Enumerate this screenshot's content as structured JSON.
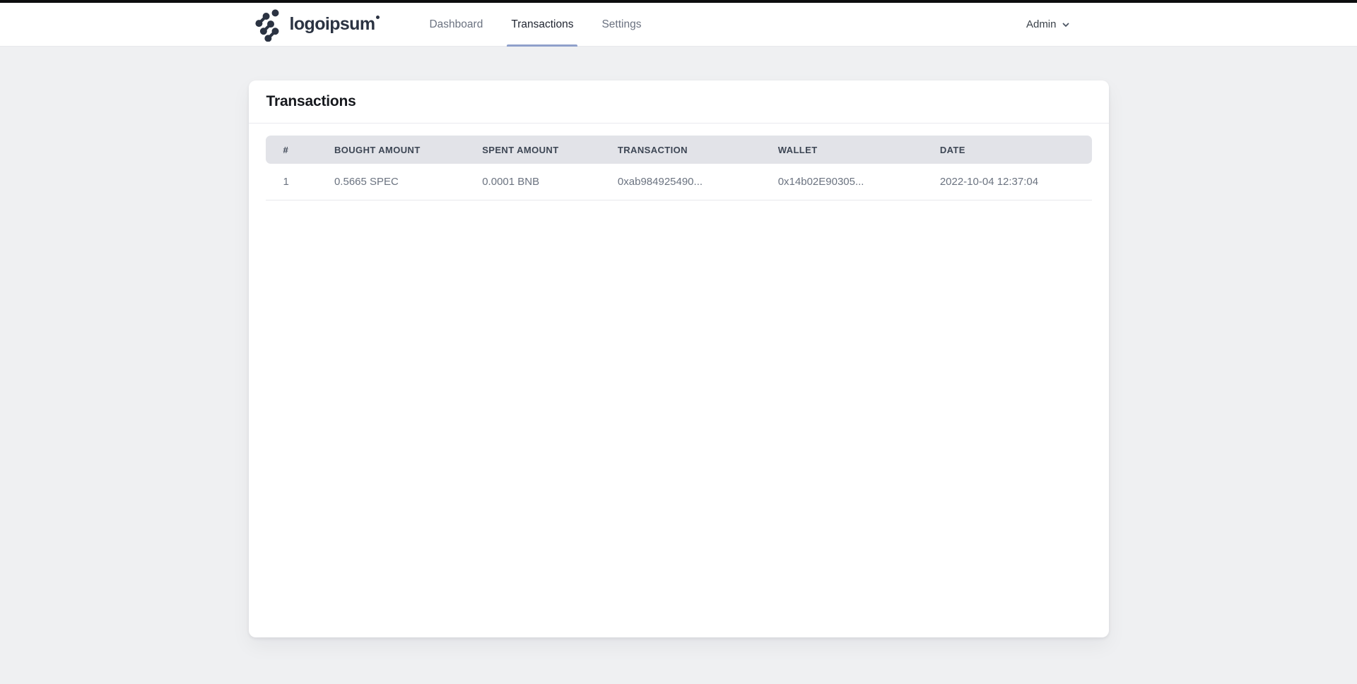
{
  "brand": {
    "name": "logoipsum"
  },
  "nav": {
    "items": [
      {
        "label": "Dashboard",
        "active": false
      },
      {
        "label": "Transactions",
        "active": true
      },
      {
        "label": "Settings",
        "active": false
      }
    ]
  },
  "user_menu": {
    "label": "Admin",
    "icon": "chevron-down-icon"
  },
  "card": {
    "title": "Transactions"
  },
  "table": {
    "columns": [
      "#",
      "BOUGHT AMOUNT",
      "SPENT AMOUNT",
      "TRANSACTION",
      "WALLET",
      "DATE"
    ],
    "rows": [
      {
        "cells": [
          "1",
          "0.5665 SPEC",
          "0.0001 BNB",
          "0xab984925490...",
          "0x14b02E90305...",
          "2022-10-04 12:37:04"
        ]
      }
    ]
  },
  "colors": {
    "accent_underline": "#8fa0cb",
    "topbar": "#0c0d0e",
    "page_background": "#eff0f2",
    "table_header_background": "#e2e3e8",
    "table_header_text": "#3d4654",
    "cell_text": "#6b7380",
    "brand_ink": "#2b3342"
  }
}
